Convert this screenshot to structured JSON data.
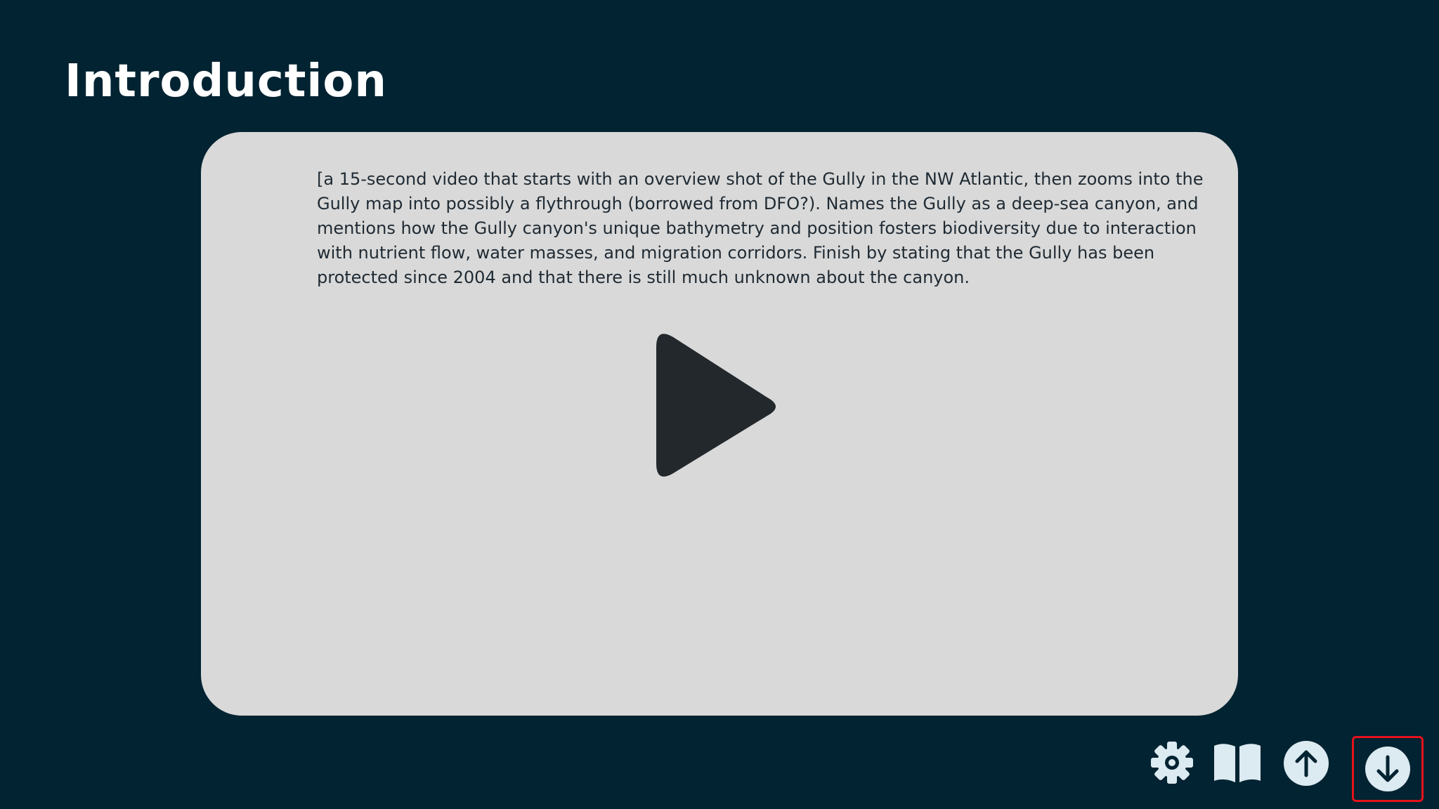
{
  "header": {
    "title": "Introduction"
  },
  "video": {
    "description": "[a 15-second video that starts with an overview shot of the Gully in the NW Atlantic, then zooms into the Gully map into possibly a flythrough (borrowed from DFO?). Names the Gully as a deep-sea canyon, and mentions how the Gully canyon's unique bathymetry and position fosters biodiversity due to interaction with nutrient flow, water masses, and migration corridors. Finish by stating that the Gully has been protected since 2004 and that there is still much unknown about the canyon.",
    "play_icon": "play-icon"
  },
  "toolbar": {
    "items": [
      {
        "icon": "gear-icon"
      },
      {
        "icon": "book-icon"
      },
      {
        "icon": "arrow-up-circle-icon"
      },
      {
        "icon": "arrow-down-circle-icon",
        "highlighted": true
      }
    ]
  },
  "colors": {
    "background": "#022331",
    "card": "#d9d9d9",
    "text": "#1f2a33",
    "play": "#22282c",
    "icon": "#dceaf1",
    "highlight": "#e5121b"
  }
}
